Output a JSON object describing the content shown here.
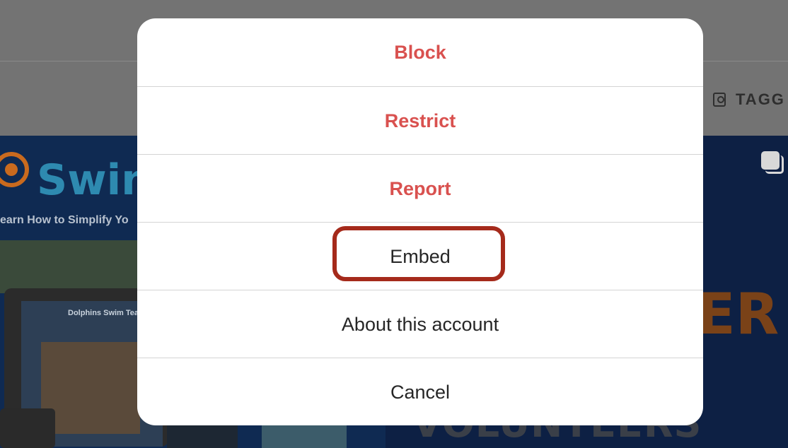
{
  "background": {
    "tab_tagged": "TAGG",
    "post_left": {
      "brand": "Swim",
      "tagline": "earn How to Simplify Yo",
      "screen_title": "Dolphins Swim Tea"
    },
    "post_right": {
      "big_letter": "ER",
      "banner": "VOLUNTEERS"
    }
  },
  "modal": {
    "items": [
      {
        "label": "Block",
        "style": "danger"
      },
      {
        "label": "Restrict",
        "style": "danger"
      },
      {
        "label": "Report",
        "style": "danger"
      },
      {
        "label": "Embed",
        "style": "normal"
      },
      {
        "label": "About this account",
        "style": "normal"
      },
      {
        "label": "Cancel",
        "style": "normal"
      }
    ]
  },
  "colors": {
    "danger": "#d9514f",
    "highlight": "#a52a1b",
    "overlay": "#7a7a7a"
  }
}
